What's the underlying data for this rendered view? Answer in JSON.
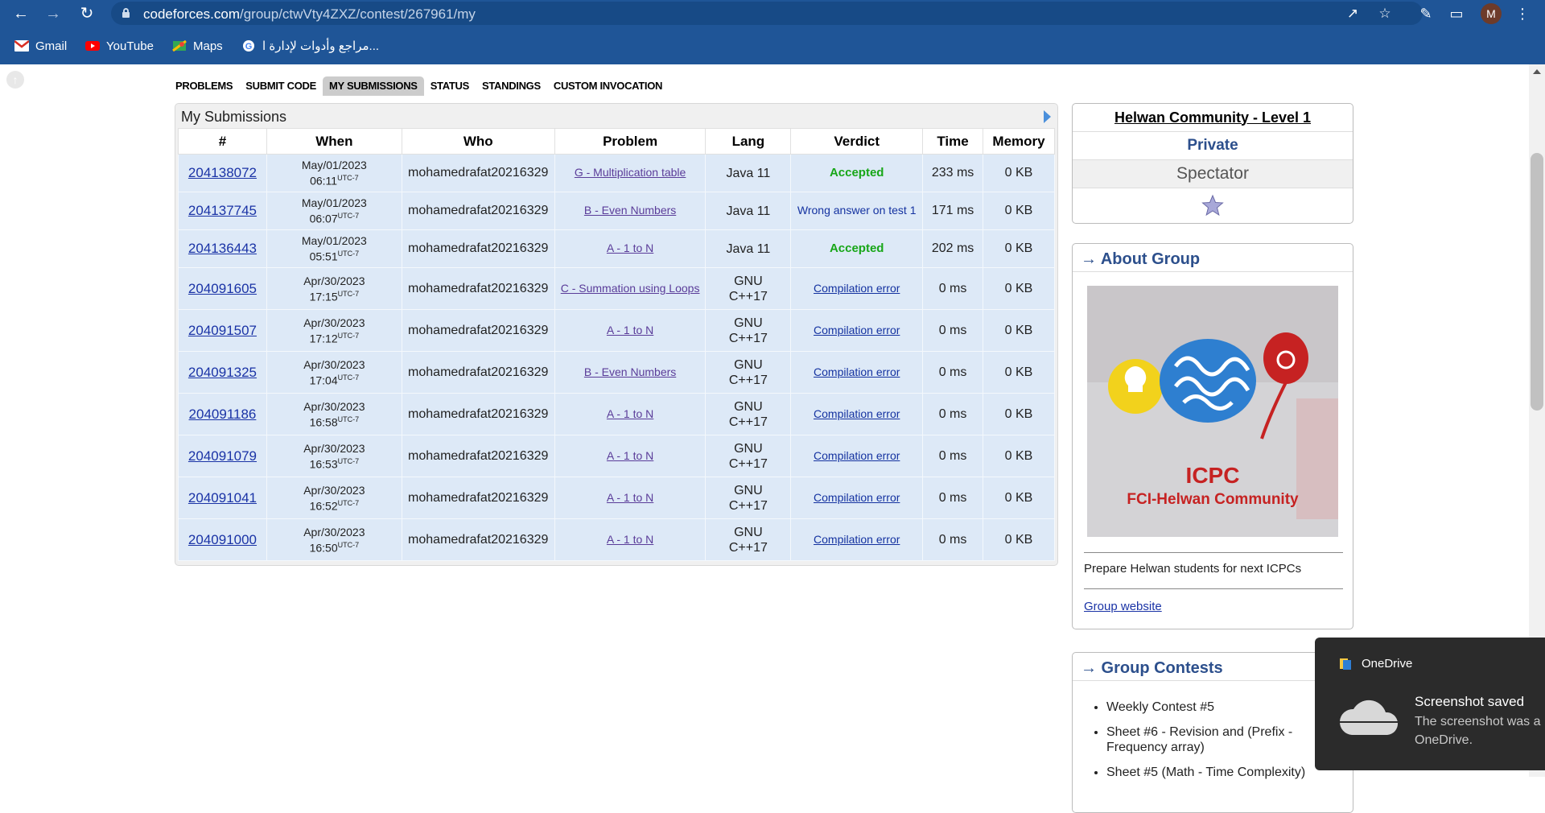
{
  "browser": {
    "url_host": "codeforces.com",
    "url_path": "/group/ctwVty4ZXZ/contest/267961/my",
    "avatar_letter": "M",
    "bookmarks": [
      {
        "label": "Gmail",
        "icon": "gmail-icon"
      },
      {
        "label": "YouTube",
        "icon": "youtube-icon"
      },
      {
        "label": "Maps",
        "icon": "maps-icon"
      },
      {
        "label": "مراجع وأدوات لإدارة ا...",
        "icon": "google-icon"
      }
    ]
  },
  "tabs": [
    "PROBLEMS",
    "SUBMIT CODE",
    "MY SUBMISSIONS",
    "STATUS",
    "STANDINGS",
    "CUSTOM INVOCATION"
  ],
  "active_tab": "MY SUBMISSIONS",
  "submissions": {
    "title": "My Submissions",
    "headers": [
      "#",
      "When",
      "Who",
      "Problem",
      "Lang",
      "Verdict",
      "Time",
      "Memory"
    ],
    "tz": "UTC-7",
    "rows": [
      {
        "id": "204138072",
        "date": "May/01/2023",
        "time": "06:11",
        "who": "mohamedrafat20216329",
        "problem": "G - Multiplication table",
        "lang": "Java 11",
        "verdict": "Accepted",
        "verdict_type": "ok",
        "run_time": "233 ms",
        "memory": "0 KB"
      },
      {
        "id": "204137745",
        "date": "May/01/2023",
        "time": "06:07",
        "who": "mohamedrafat20216329",
        "problem": "B - Even Numbers",
        "lang": "Java 11",
        "verdict": "Wrong answer on test 1",
        "verdict_type": "wa",
        "run_time": "171 ms",
        "memory": "0 KB"
      },
      {
        "id": "204136443",
        "date": "May/01/2023",
        "time": "05:51",
        "who": "mohamedrafat20216329",
        "problem": "A - 1 to N",
        "lang": "Java 11",
        "verdict": "Accepted",
        "verdict_type": "ok",
        "run_time": "202 ms",
        "memory": "0 KB"
      },
      {
        "id": "204091605",
        "date": "Apr/30/2023",
        "time": "17:15",
        "who": "mohamedrafat20216329",
        "problem": "C - Summation using Loops",
        "lang": "GNU C++17",
        "verdict": "Compilation error",
        "verdict_type": "ce",
        "run_time": "0 ms",
        "memory": "0 KB"
      },
      {
        "id": "204091507",
        "date": "Apr/30/2023",
        "time": "17:12",
        "who": "mohamedrafat20216329",
        "problem": "A - 1 to N",
        "lang": "GNU C++17",
        "verdict": "Compilation error",
        "verdict_type": "ce",
        "run_time": "0 ms",
        "memory": "0 KB"
      },
      {
        "id": "204091325",
        "date": "Apr/30/2023",
        "time": "17:04",
        "who": "mohamedrafat20216329",
        "problem": "B - Even Numbers",
        "lang": "GNU C++17",
        "verdict": "Compilation error",
        "verdict_type": "ce",
        "run_time": "0 ms",
        "memory": "0 KB"
      },
      {
        "id": "204091186",
        "date": "Apr/30/2023",
        "time": "16:58",
        "who": "mohamedrafat20216329",
        "problem": "A - 1 to N",
        "lang": "GNU C++17",
        "verdict": "Compilation error",
        "verdict_type": "ce",
        "run_time": "0 ms",
        "memory": "0 KB"
      },
      {
        "id": "204091079",
        "date": "Apr/30/2023",
        "time": "16:53",
        "who": "mohamedrafat20216329",
        "problem": "A - 1 to N",
        "lang": "GNU C++17",
        "verdict": "Compilation error",
        "verdict_type": "ce",
        "run_time": "0 ms",
        "memory": "0 KB"
      },
      {
        "id": "204091041",
        "date": "Apr/30/2023",
        "time": "16:52",
        "who": "mohamedrafat20216329",
        "problem": "A - 1 to N",
        "lang": "GNU C++17",
        "verdict": "Compilation error",
        "verdict_type": "ce",
        "run_time": "0 ms",
        "memory": "0 KB"
      },
      {
        "id": "204091000",
        "date": "Apr/30/2023",
        "time": "16:50",
        "who": "mohamedrafat20216329",
        "problem": "A - 1 to N",
        "lang": "GNU C++17",
        "verdict": "Compilation error",
        "verdict_type": "ce",
        "run_time": "0 ms",
        "memory": "0 KB"
      }
    ]
  },
  "sidebar": {
    "group_name": "Helwan Community - Level 1",
    "privacy": "Private",
    "role": "Spectator",
    "about": {
      "heading": "→ About Group",
      "logo_line1": "ICPC",
      "logo_line2": "FCI-Helwan Community",
      "description": "Prepare Helwan students for next ICPCs",
      "website_label": "Group website"
    },
    "contests": {
      "heading": "→ Group Contests",
      "items": [
        "Weekly Contest #5",
        "Sheet #6 - Revision and (Prefix - Frequency array)",
        "Sheet #5 (Math - Time Complexity)"
      ]
    }
  },
  "toast": {
    "app": "OneDrive",
    "title": "Screenshot saved",
    "body": "The screenshot was a OneDrive."
  },
  "colors": {
    "chrome_blue": "#1f5597",
    "accepted": "#17a617",
    "link": "#1a33a6",
    "row_bg": "#dde9f7"
  }
}
